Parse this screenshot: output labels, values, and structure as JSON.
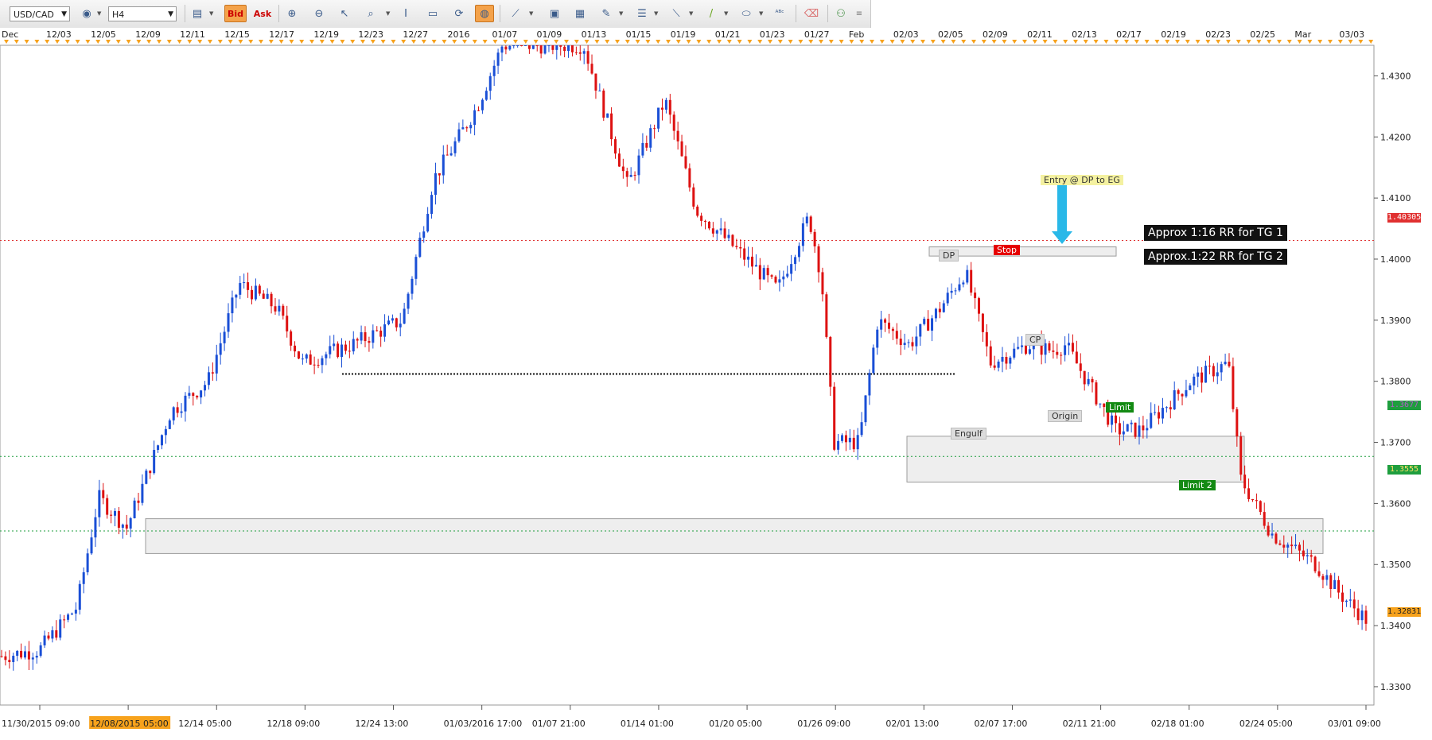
{
  "toolbar": {
    "symbol": "USD/CAD",
    "timeframe": "H4",
    "bid_label": "Bid",
    "ask_label": "Ask",
    "icons": [
      "view-icon",
      "chart-type-icon",
      "bid-toggle",
      "ask-toggle",
      "zoom-in-icon",
      "zoom-out-icon",
      "cursor-icon",
      "magnifier-icon",
      "text-tool-icon",
      "screenshot-icon",
      "sync-icon",
      "globe-icon",
      "ruler-icon",
      "image-icon",
      "template-icon",
      "draw-tool-icon",
      "lines-icon",
      "trend-icon",
      "line-icon",
      "ellipse-icon",
      "abc-text-icon",
      "eraser-icon",
      "objects-icon",
      "more-icon"
    ]
  },
  "colors": {
    "bull": "#1a4fd6",
    "bear": "#dd1111",
    "stop_line": "#e03030",
    "limit_line": "#1e9e3e",
    "zone_fill": "#eeeeee",
    "axis_highlight": "#f7a21c"
  },
  "top_axis_labels": [
    "Dec",
    "12/03",
    "12/05",
    "12/09",
    "12/11",
    "12/15",
    "12/17",
    "12/19",
    "12/23",
    "12/27",
    "2016",
    "01/07",
    "01/09",
    "01/13",
    "01/15",
    "01/19",
    "01/21",
    "01/23",
    "01/27",
    "Feb",
    "02/03",
    "02/05",
    "02/09",
    "02/11",
    "02/13",
    "02/17",
    "02/19",
    "02/23",
    "02/25",
    "Mar",
    "03/03"
  ],
  "bottom_axis_labels": [
    "11/30/2015 09:00",
    "12/08/2015 05:00",
    "12/14 05:00",
    "12/18 09:00",
    "12/24 13:00",
    "01/03/2016 17:00",
    "01/07 21:00",
    "01/14 01:00",
    "01/20 05:00",
    "01/26 09:00",
    "02/01 13:00",
    "02/07 17:00",
    "02/11 21:00",
    "02/18 01:00",
    "02/24 05:00",
    "03/01 09:00"
  ],
  "price_axis_labels": [
    "1.4300",
    "1.4200",
    "1.4100",
    "1.4000",
    "1.3900",
    "1.3800",
    "1.3700",
    "1.3600",
    "1.3500",
    "1.3400",
    "1.3300"
  ],
  "price_tags": {
    "stop": "1.40305",
    "limit": "1.3677",
    "limit2": "1.3555",
    "current": "1.32831"
  },
  "annotations": {
    "entry": "Entry @ DP to EG",
    "stop": "Stop",
    "dp": "DP",
    "cp": "CP",
    "origin": "Origin",
    "engulf": "Engulf",
    "limit": "Limit",
    "limit2": "Limit 2",
    "rr1": "Approx 1:16 RR for TG 1",
    "rr2": "Approx.1:22 RR for TG 2"
  },
  "levels": {
    "stop": 1.40305,
    "limit": 1.3677,
    "limit2": 1.3555,
    "prior_low": 1.3812
  },
  "chart_data": {
    "type": "candlestick",
    "instrument": "USD/CAD",
    "timeframe": "H4",
    "ylim": [
      1.327,
      1.435
    ],
    "x_start": "11/30/2015 09:00",
    "x_end": "03/03/2016",
    "waypoints": [
      [
        0,
        1.335
      ],
      [
        60,
        1.336
      ],
      [
        120,
        1.343
      ],
      [
        155,
        1.361
      ],
      [
        200,
        1.356
      ],
      [
        270,
        1.375
      ],
      [
        330,
        1.38
      ],
      [
        380,
        1.396
      ],
      [
        440,
        1.392
      ],
      [
        480,
        1.383
      ],
      [
        560,
        1.386
      ],
      [
        640,
        1.39
      ],
      [
        690,
        1.413
      ],
      [
        760,
        1.425
      ],
      [
        800,
        1.435
      ],
      [
        930,
        1.435
      ],
      [
        1000,
        1.412
      ],
      [
        1060,
        1.426
      ],
      [
        1110,
        1.408
      ],
      [
        1170,
        1.402
      ],
      [
        1240,
        1.395
      ],
      [
        1290,
        1.407
      ],
      [
        1310,
        1.397
      ],
      [
        1330,
        1.37
      ],
      [
        1370,
        1.37
      ],
      [
        1400,
        1.39
      ],
      [
        1450,
        1.386
      ],
      [
        1500,
        1.392
      ],
      [
        1540,
        1.398
      ],
      [
        1580,
        1.383
      ],
      [
        1640,
        1.386
      ],
      [
        1680,
        1.385
      ],
      [
        1700,
        1.386
      ],
      [
        1740,
        1.379
      ],
      [
        1780,
        1.372
      ],
      [
        1820,
        1.372
      ],
      [
        1900,
        1.38
      ],
      [
        1960,
        1.383
      ],
      [
        1980,
        1.364
      ],
      [
        2030,
        1.355
      ],
      [
        2100,
        1.35
      ],
      [
        2140,
        1.345
      ],
      [
        2180,
        1.341
      ]
    ]
  }
}
